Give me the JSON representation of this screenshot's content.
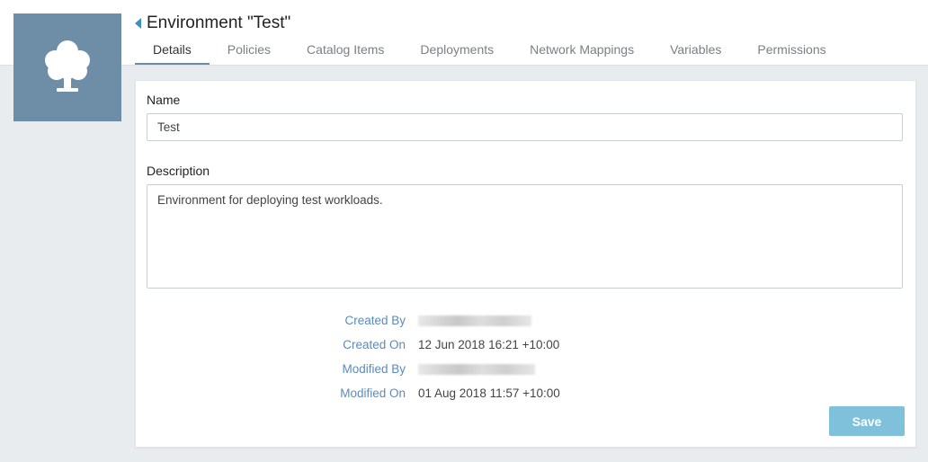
{
  "header": {
    "title": "Environment \"Test\"",
    "tile_icon": "tree-icon",
    "back_icon": "caret-left-icon"
  },
  "tabs": [
    {
      "label": "Details",
      "active": true
    },
    {
      "label": "Policies",
      "active": false
    },
    {
      "label": "Catalog Items",
      "active": false
    },
    {
      "label": "Deployments",
      "active": false
    },
    {
      "label": "Network Mappings",
      "active": false
    },
    {
      "label": "Variables",
      "active": false
    },
    {
      "label": "Permissions",
      "active": false
    }
  ],
  "form": {
    "name_label": "Name",
    "name_value": "Test",
    "description_label": "Description",
    "description_value": "Environment for deploying test workloads."
  },
  "meta": {
    "created_by_label": "Created By",
    "created_on_label": "Created On",
    "created_on_value": "12 Jun 2018 16:21 +10:00",
    "modified_by_label": "Modified By",
    "modified_on_label": "Modified On",
    "modified_on_value": "01 Aug 2018 11:57 +10:00"
  },
  "actions": {
    "save_label": "Save"
  },
  "colors": {
    "tile": "#6d8ea6",
    "accent_link": "#5a8bbd",
    "save_button": "#7fc1da",
    "active_tab_underline": "#6b8ca6"
  }
}
